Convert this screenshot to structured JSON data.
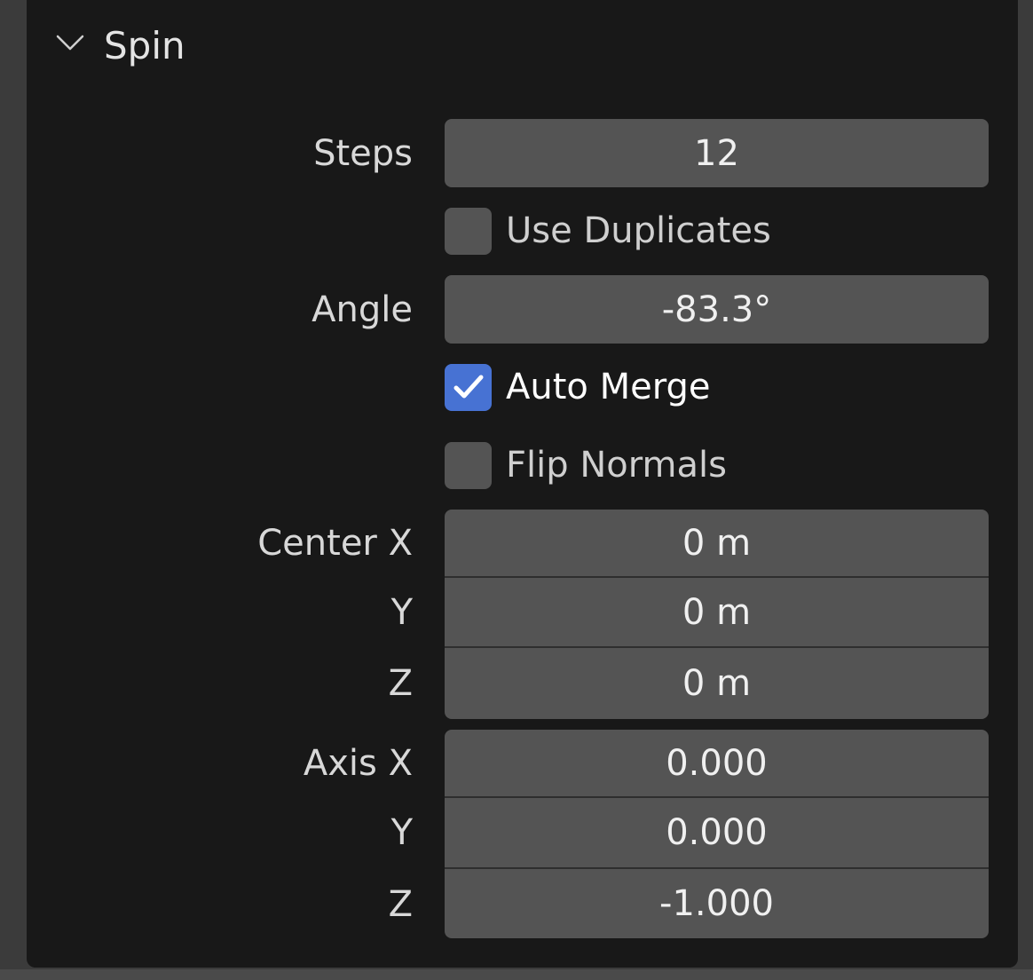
{
  "panel": {
    "title": "Spin",
    "collapse_icon": "chevron-down-icon"
  },
  "fields": {
    "steps": {
      "label": "Steps",
      "value": "12"
    },
    "angle": {
      "label": "Angle",
      "value": "-83.3°"
    },
    "center": {
      "label": "Center X",
      "y_label": "Y",
      "z_label": "Z",
      "x": "0 m",
      "y": "0 m",
      "z": "0 m"
    },
    "axis": {
      "label": "Axis X",
      "y_label": "Y",
      "z_label": "Z",
      "x": "0.000",
      "y": "0.000",
      "z": "-1.000"
    }
  },
  "checkboxes": {
    "use_duplicates": {
      "label": "Use Duplicates",
      "checked": false
    },
    "auto_merge": {
      "label": "Auto Merge",
      "checked": true
    },
    "flip_normals": {
      "label": "Flip Normals",
      "checked": false
    }
  },
  "colors": {
    "panel_bg": "#181818",
    "field_bg": "#545454",
    "accent": "#4772d3"
  }
}
